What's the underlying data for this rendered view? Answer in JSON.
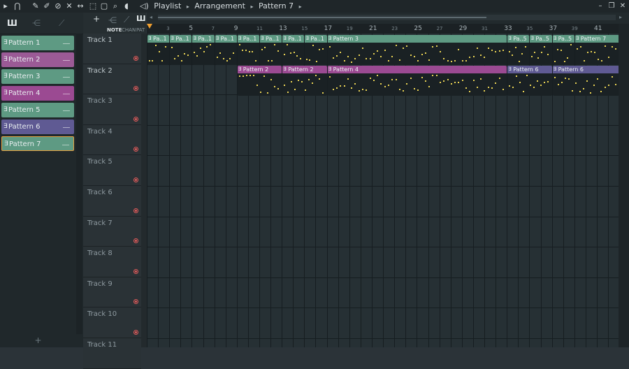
{
  "breadcrumb": [
    "Playlist",
    "Arrangement",
    "Pattern 7"
  ],
  "toolbar_icons": [
    "menu-arrow-icon",
    "magnet-icon",
    "pencil-icon",
    "brush-icon",
    "delete-icon",
    "mute-icon",
    "slip-icon",
    "select-icon",
    "zoom-icon",
    "playback-icon"
  ],
  "browser": {
    "patterns": [
      {
        "label": "Pattern 1",
        "color": "#5e9a83"
      },
      {
        "label": "Pattern 2",
        "color": "#9b5a96"
      },
      {
        "label": "Pattern 3",
        "color": "#5e9a83"
      },
      {
        "label": "Pattern 4",
        "color": "#9b4a92"
      },
      {
        "label": "Pattern 5",
        "color": "#5e9a83"
      },
      {
        "label": "Pattern 6",
        "color": "#5f5a93"
      },
      {
        "label": "Pattern 7",
        "color": "#5e9a83",
        "selected": true
      }
    ],
    "add_label": "+"
  },
  "trackbar": {
    "note": "NOTE",
    "chan": "CHAN",
    "pat": "PAT"
  },
  "ruler": {
    "bars": [
      "3",
      "5",
      "7",
      "9",
      "11",
      "13",
      "15",
      "17",
      "19",
      "21",
      "23",
      "25",
      "27",
      "29",
      "31",
      "33",
      "35",
      "37",
      "39",
      "41"
    ]
  },
  "tracks": [
    {
      "name": "Track 1"
    },
    {
      "name": "Track 2"
    },
    {
      "name": "Track 3"
    },
    {
      "name": "Track 4"
    },
    {
      "name": "Track 5"
    },
    {
      "name": "Track 6"
    },
    {
      "name": "Track 7"
    },
    {
      "name": "Track 8"
    },
    {
      "name": "Track 9"
    },
    {
      "name": "Track 10"
    },
    {
      "name": "Track 11"
    }
  ],
  "clips_track1": [
    "Pa..1",
    "Pa..1",
    "Pa..1",
    "Pa..1",
    "Pa..1",
    "Pa..1",
    "Pa..1",
    "Pa..1",
    "Pattern 3",
    "Pa..5",
    "Pa..5",
    "Pa..5",
    "Pattern 7"
  ],
  "clips_track2": [
    "Pattern 2",
    "Pattern 2",
    "Pattern 4",
    "Pattern 6",
    "Pattern 6"
  ],
  "colors": {
    "green": "#5e9a83",
    "purple": "#9b4a92",
    "indigo": "#5f5a93",
    "note": "#e8d253",
    "accent": "#f0a030"
  }
}
